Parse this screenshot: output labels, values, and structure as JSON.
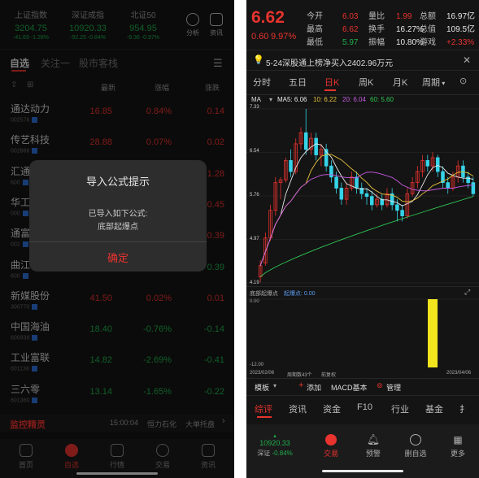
{
  "left": {
    "indices": [
      {
        "name": "上证指数",
        "value": "3204.75",
        "change": "-41.69 -1.28%"
      },
      {
        "name": "深证成指",
        "value": "10920.33",
        "change": "-92.25 -0.84%"
      },
      {
        "name": "北证50",
        "value": "954.95",
        "change": "-9.36 -0.97%"
      }
    ],
    "top_icons": {
      "analysis": "分析",
      "news": "资讯"
    },
    "tabs": [
      "自选",
      "关注一",
      "股市客栈"
    ],
    "columns": {
      "price": "最新",
      "pct": "涨幅",
      "change": "涨跌"
    },
    "stocks": [
      {
        "name": "通达动力",
        "code": "002576",
        "price": "16.85",
        "pct": "0.84%",
        "change": "0.14",
        "up": true
      },
      {
        "name": "传艺科技",
        "code": "002866",
        "price": "28.88",
        "pct": "0.07%",
        "change": "0.02",
        "up": true
      },
      {
        "name": "汇通",
        "code": "600",
        "price": "",
        "pct": "",
        "change": "1.28",
        "up": true
      },
      {
        "name": "华工",
        "code": "000",
        "price": "",
        "pct": "",
        "change": "0.45",
        "up": true
      },
      {
        "name": "通富",
        "code": "002",
        "price": "",
        "pct": "",
        "change": "0.39",
        "up": true
      },
      {
        "name": "曲江",
        "code": "600",
        "price": "",
        "pct": "",
        "change": "0.39",
        "up": false
      },
      {
        "name": "新媒股份",
        "code": "300770",
        "price": "41.50",
        "pct": "0.02%",
        "change": "0.01",
        "up": true
      },
      {
        "name": "中国海油",
        "code": "600938",
        "price": "18.40",
        "pct": "-0.76%",
        "change": "-0.14",
        "up": false
      },
      {
        "name": "工业富联",
        "code": "601138",
        "price": "14.82",
        "pct": "-2.69%",
        "change": "-0.41",
        "up": false
      },
      {
        "name": "三六零",
        "code": "601360",
        "price": "13.14",
        "pct": "-1.65%",
        "change": "-0.22",
        "up": false
      }
    ],
    "ticker": {
      "brand": "监控精灵",
      "time": "15:00:04",
      "text1": "恒力石化",
      "text2": "大单托盘"
    },
    "dialog": {
      "title": "导入公式提示",
      "line1": "已导入如下公式:",
      "line2": "底部起爆点",
      "confirm": "确定"
    },
    "nav": [
      "首页",
      "自选",
      "行情",
      "交易",
      "资讯"
    ]
  },
  "right": {
    "price": "6.62",
    "change": "0.60",
    "pct": "9.97%",
    "quote_rows": [
      [
        {
          "l": "今开",
          "v": "6.03",
          "c": "red"
        },
        {
          "l": "量比",
          "v": "1.99",
          "c": "red"
        },
        {
          "l": "总额",
          "v": "16.97亿",
          "c": "white"
        }
      ],
      [
        {
          "l": "最高",
          "v": "6.62",
          "c": "red"
        },
        {
          "l": "换手",
          "v": "16.27%",
          "c": "white"
        },
        {
          "l": "总值",
          "v": "109.5亿",
          "c": "white"
        }
      ],
      [
        {
          "l": "最低",
          "v": "5.97",
          "c": "green"
        },
        {
          "l": "振幅",
          "v": "10.80%",
          "c": "white"
        },
        {
          "l": "游戏",
          "v": "+2.33%",
          "c": "red"
        }
      ]
    ],
    "notice": "5-24深股通上榜净买入2402.96万元",
    "period_tabs": [
      "分时",
      "五日",
      "日K",
      "周K",
      "月K",
      "周期"
    ],
    "ma_legend": {
      "label": "MA",
      "ma5": "MA5: 6.06",
      "ma10": "10: 6.22",
      "ma20": "20: 6.04",
      "ma60": "60: 5.60"
    },
    "price_axis": [
      "7.33",
      "6.54",
      "5.76",
      "4.97",
      "4.19"
    ],
    "indicator": {
      "name": "底部起爆点",
      "value": "起爆点: 0.00",
      "top": "0.00",
      "bottom": "-12.00"
    },
    "dates": {
      "start": "2023/02/06",
      "count": "周期数43个",
      "restore": "前复权",
      "end": "2023/04/06"
    },
    "toolbar": {
      "template": "模板",
      "add": "添加",
      "macd": "MACD基本",
      "manage": "管理"
    },
    "bottom_tabs": [
      "综评",
      "资讯",
      "资金",
      "F10",
      "行业",
      "基金",
      "扌"
    ],
    "nav": {
      "index_value": "10920.33",
      "index_name": "深证",
      "index_pct": "-0.84%",
      "items": [
        "交易",
        "预警",
        "删自选",
        "更多"
      ]
    }
  },
  "chart_data": {
    "type": "candlestick",
    "candles": [
      {
        "o": 4.3,
        "c": 4.5,
        "h": 4.6,
        "l": 4.2
      },
      {
        "o": 4.55,
        "c": 5.0,
        "h": 5.1,
        "l": 4.5
      },
      {
        "o": 5.0,
        "c": 5.5,
        "h": 5.6,
        "l": 4.95
      },
      {
        "o": 5.5,
        "c": 6.0,
        "h": 6.1,
        "l": 5.4
      },
      {
        "o": 6.0,
        "c": 6.05,
        "h": 6.1,
        "l": 5.7
      },
      {
        "o": 6.05,
        "c": 6.4,
        "h": 6.45,
        "l": 6.0
      },
      {
        "o": 6.4,
        "c": 6.2,
        "h": 6.6,
        "l": 6.1
      },
      {
        "o": 6.2,
        "c": 6.7,
        "h": 6.8,
        "l": 6.15
      },
      {
        "o": 6.7,
        "c": 6.9,
        "h": 7.0,
        "l": 6.6
      },
      {
        "o": 6.9,
        "c": 6.6,
        "h": 7.33,
        "l": 6.5
      },
      {
        "o": 6.6,
        "c": 6.8,
        "h": 6.9,
        "l": 6.5
      },
      {
        "o": 6.8,
        "c": 6.5,
        "h": 6.9,
        "l": 6.4
      },
      {
        "o": 6.5,
        "c": 6.6,
        "h": 6.7,
        "l": 6.3
      },
      {
        "o": 6.6,
        "c": 6.3,
        "h": 6.7,
        "l": 6.2
      },
      {
        "o": 6.3,
        "c": 6.1,
        "h": 6.4,
        "l": 6.0
      },
      {
        "o": 6.1,
        "c": 5.9,
        "h": 6.2,
        "l": 5.8
      },
      {
        "o": 5.9,
        "c": 5.7,
        "h": 6.0,
        "l": 5.6
      },
      {
        "o": 5.7,
        "c": 5.9,
        "h": 6.0,
        "l": 5.6
      },
      {
        "o": 5.9,
        "c": 6.1,
        "h": 6.2,
        "l": 5.85
      },
      {
        "o": 6.1,
        "c": 5.9,
        "h": 6.2,
        "l": 5.8
      },
      {
        "o": 5.9,
        "c": 5.8,
        "h": 6.0,
        "l": 5.7
      },
      {
        "o": 5.8,
        "c": 5.75,
        "h": 5.9,
        "l": 5.6
      },
      {
        "o": 5.75,
        "c": 5.6,
        "h": 5.85,
        "l": 5.5
      },
      {
        "o": 5.6,
        "c": 5.7,
        "h": 5.8,
        "l": 5.55
      },
      {
        "o": 5.7,
        "c": 5.6,
        "h": 5.8,
        "l": 5.5
      },
      {
        "o": 5.6,
        "c": 5.8,
        "h": 5.9,
        "l": 5.55
      },
      {
        "o": 5.8,
        "c": 5.6,
        "h": 5.9,
        "l": 5.5
      },
      {
        "o": 5.6,
        "c": 5.5,
        "h": 5.7,
        "l": 5.3
      },
      {
        "o": 5.5,
        "c": 5.4,
        "h": 5.6,
        "l": 5.3
      },
      {
        "o": 5.4,
        "c": 5.8,
        "h": 5.9,
        "l": 5.35
      },
      {
        "o": 5.8,
        "c": 6.0,
        "h": 6.1,
        "l": 5.75
      },
      {
        "o": 6.0,
        "c": 6.2,
        "h": 6.3,
        "l": 5.9
      },
      {
        "o": 6.2,
        "c": 6.4,
        "h": 6.5,
        "l": 6.1
      },
      {
        "o": 6.4,
        "c": 6.3,
        "h": 6.5,
        "l": 6.2
      },
      {
        "o": 6.3,
        "c": 6.45,
        "h": 6.55,
        "l": 6.2
      },
      {
        "o": 6.45,
        "c": 6.2,
        "h": 6.5,
        "l": 6.1
      },
      {
        "o": 6.2,
        "c": 6.0,
        "h": 6.3,
        "l": 5.9
      },
      {
        "o": 6.0,
        "c": 5.9,
        "h": 6.1,
        "l": 5.8
      },
      {
        "o": 5.9,
        "c": 6.1,
        "h": 6.2,
        "l": 5.85
      },
      {
        "o": 6.1,
        "c": 6.3,
        "h": 6.4,
        "l": 6.0
      },
      {
        "o": 6.3,
        "c": 6.1,
        "h": 6.4,
        "l": 6.0
      },
      {
        "o": 6.1,
        "c": 6.0,
        "h": 6.2,
        "l": 5.9
      },
      {
        "o": 6.0,
        "c": 5.8,
        "h": 6.1,
        "l": 5.75
      }
    ],
    "ylim": [
      4.19,
      7.33
    ],
    "indicator_spike_index": 34
  },
  "colors": {
    "up": "#e8332e",
    "down": "#36d3e8",
    "accent": "#e8332e",
    "green": "#1fae4b",
    "ma5": "#e8e8e8",
    "ma10": "#e5c13a",
    "ma20": "#c75ae0",
    "ma60": "#2fc653"
  }
}
